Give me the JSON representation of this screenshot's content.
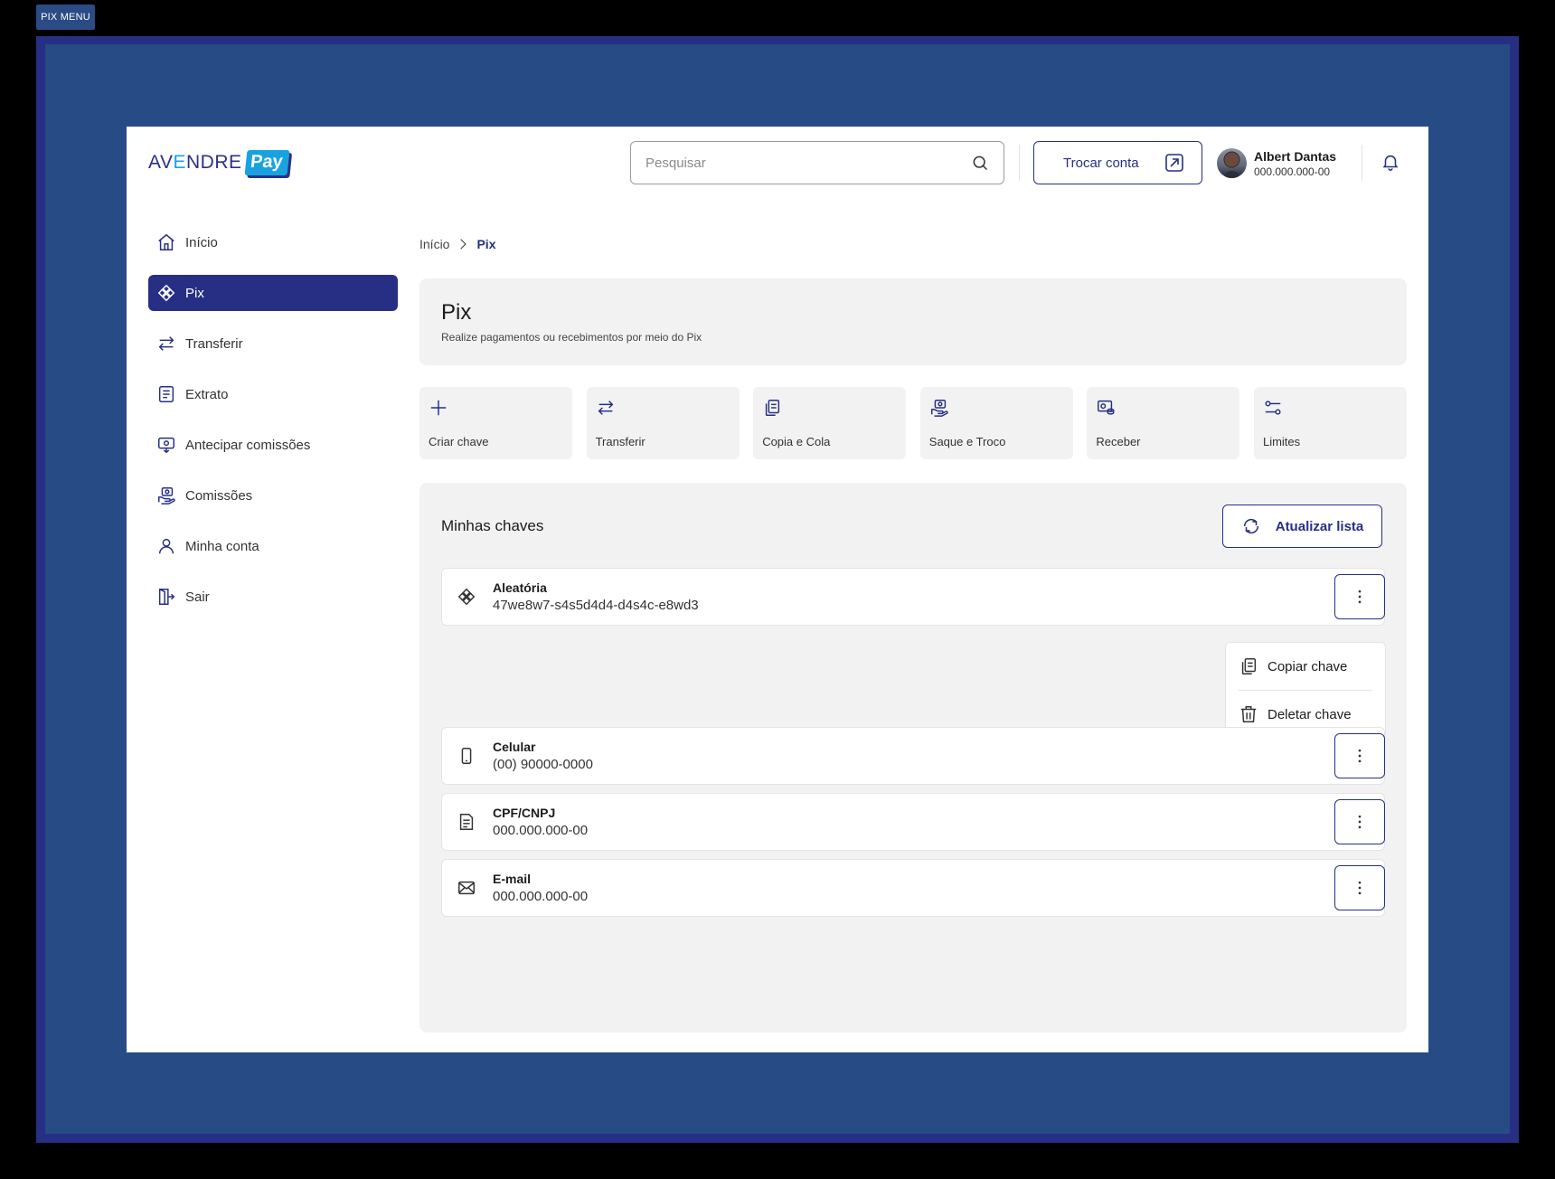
{
  "frame": {
    "tag": "PIX MENU"
  },
  "brand": {
    "logo_main_a": "AV",
    "logo_main_e": "E",
    "logo_main_b": "NDRE",
    "logo_badge": "Pay"
  },
  "header": {
    "search_placeholder": "Pesquisar",
    "switch_account_label": "Trocar conta",
    "user": {
      "name": "Albert Dantas",
      "document": "000.000.000-00"
    }
  },
  "sidebar": {
    "items": [
      {
        "label": "Início",
        "icon": "home-icon"
      },
      {
        "label": "Pix",
        "icon": "pix-icon",
        "active": true
      },
      {
        "label": "Transferir",
        "icon": "transfer-icon"
      },
      {
        "label": "Extrato",
        "icon": "statement-icon"
      },
      {
        "label": "Antecipar comissões",
        "icon": "anticipate-icon"
      },
      {
        "label": "Comissões",
        "icon": "commissions-icon"
      },
      {
        "label": "Minha conta",
        "icon": "user-icon"
      },
      {
        "label": "Sair",
        "icon": "logout-icon"
      }
    ]
  },
  "breadcrumb": {
    "root": "Início",
    "current": "Pix"
  },
  "page": {
    "title": "Pix",
    "subtitle": "Realize pagamentos ou recebimentos por meio do Pix"
  },
  "actions": [
    {
      "label": "Criar chave",
      "icon": "plus-icon"
    },
    {
      "label": "Transferir",
      "icon": "transfer-icon"
    },
    {
      "label": "Copia e Cola",
      "icon": "copy-paste-icon"
    },
    {
      "label": "Saque e Troco",
      "icon": "withdraw-icon"
    },
    {
      "label": "Receber",
      "icon": "receive-icon"
    },
    {
      "label": "Limites",
      "icon": "limits-icon"
    }
  ],
  "keys": {
    "title": "Minhas chaves",
    "refresh_label": "Atualizar lista",
    "items": [
      {
        "type": "Aleatória",
        "value": "47we8w7-s4s5d4d4-d4s4c-e8wd3",
        "icon": "pix-icon"
      },
      {
        "type": "Celular",
        "value": "(00) 90000-0000",
        "icon": "phone-icon"
      },
      {
        "type": "CPF/CNPJ",
        "value": "000.000.000-00",
        "icon": "document-icon"
      },
      {
        "type": "E-mail",
        "value": "000.000.000-00",
        "icon": "mail-icon"
      }
    ],
    "menu": {
      "copy_label": "Copiar chave",
      "delete_label": "Deletar chave"
    }
  },
  "colors": {
    "primary": "#272f85",
    "brand_blue": "#19a2e0",
    "panel": "#f2f2f2",
    "frame": "#274b84"
  }
}
